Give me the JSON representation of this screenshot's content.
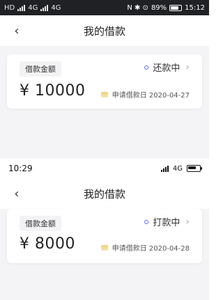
{
  "top": {
    "status_bar": {
      "left_text": "HD",
      "signal_left": "4G",
      "signal_left2": "4G",
      "right_text": "N ✱ ⊙",
      "battery_percent": "89%",
      "time": "15:12"
    },
    "nav": {
      "title": "我的借款",
      "back_icon": "chevron-left-icon"
    },
    "card": {
      "tag_label": "借款金额",
      "status_label": "还款中",
      "amount": "¥ 10000",
      "date_label": "申请借款日 2020-04-27"
    }
  },
  "bottom": {
    "status_bar": {
      "time": "10:29",
      "network": "4G",
      "battery_level": 0.7
    },
    "nav": {
      "title": "我的借款",
      "back_icon": "chevron-left-icon"
    },
    "card": {
      "tag_label": "借款金额",
      "status_label": "打款中",
      "amount": "¥ 8000",
      "date_label": "申请借款日 2020-04-28"
    }
  },
  "colors": {
    "accent_dot": "#5b6ef5",
    "page_bg": "#f4f4f6",
    "card_bg": "#ffffff"
  }
}
